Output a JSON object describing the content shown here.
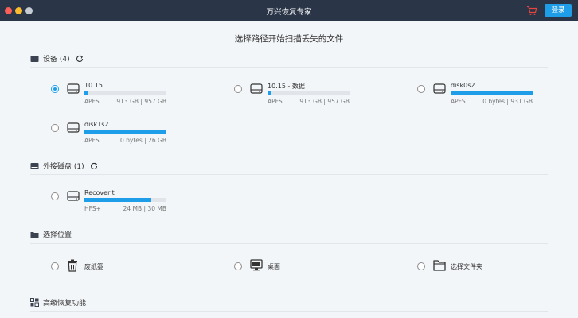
{
  "window": {
    "title": "万兴恢复专家",
    "login_label": "登录"
  },
  "main": {
    "heading": "选择路径开始扫描丢失的文件"
  },
  "devices": {
    "title": "设备 (4)",
    "items": [
      {
        "name": "10.15",
        "fs": "APFS",
        "size": "913 GB | 957 GB",
        "used_fraction": 0.04,
        "selected": true
      },
      {
        "name": "10.15 - 数据",
        "fs": "APFS",
        "size": "913 GB | 957 GB",
        "used_fraction": 0.04,
        "selected": false
      },
      {
        "name": "disk0s2",
        "fs": "APFS",
        "size": "0 bytes | 931 GB",
        "used_fraction": 1.0,
        "selected": false
      },
      {
        "name": "disk1s2",
        "fs": "APFS",
        "size": "0 bytes | 26 GB",
        "used_fraction": 1.0,
        "selected": false
      }
    ]
  },
  "external": {
    "title": "外接磁盘 (1)",
    "items": [
      {
        "name": "Recoverit",
        "fs": "HFS+",
        "size": "24 MB | 30 MB",
        "used_fraction": 0.82,
        "selected": false
      }
    ]
  },
  "locations": {
    "title": "选择位置",
    "items": [
      {
        "label": "废纸篓",
        "icon": "trash-icon"
      },
      {
        "label": "桌面",
        "icon": "desktop-icon"
      },
      {
        "label": "选择文件夹",
        "icon": "folder-icon"
      }
    ]
  },
  "advanced": {
    "title": "高级恢复功能"
  },
  "colors": {
    "accent": "#1e9ee8",
    "titlebar": "#2a3547",
    "background": "#f3f6f9"
  }
}
